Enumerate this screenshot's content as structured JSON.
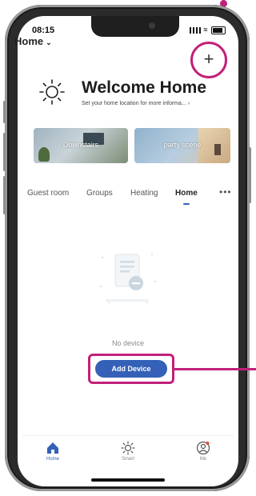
{
  "status_bar": {
    "time": "08:15"
  },
  "header": {
    "home_label": "Home"
  },
  "welcome": {
    "title": "Welcome Home",
    "subtitle": "Set your home location for more informa..."
  },
  "scenes": [
    {
      "label": "Downstairs"
    },
    {
      "label": "party scene"
    }
  ],
  "rooms_tabs": [
    "Guest room",
    "Groups",
    "Heating",
    "Home"
  ],
  "active_tab": "Home",
  "empty_state": {
    "message": "No device",
    "button_label": "Add Device"
  },
  "tab_bar": [
    {
      "label": "Home",
      "icon": "home-icon"
    },
    {
      "label": "Smart",
      "icon": "sun-icon"
    },
    {
      "label": "Me",
      "icon": "profile-icon"
    }
  ],
  "colors": {
    "accent": "#3461b7",
    "callout": "#c2207a"
  }
}
